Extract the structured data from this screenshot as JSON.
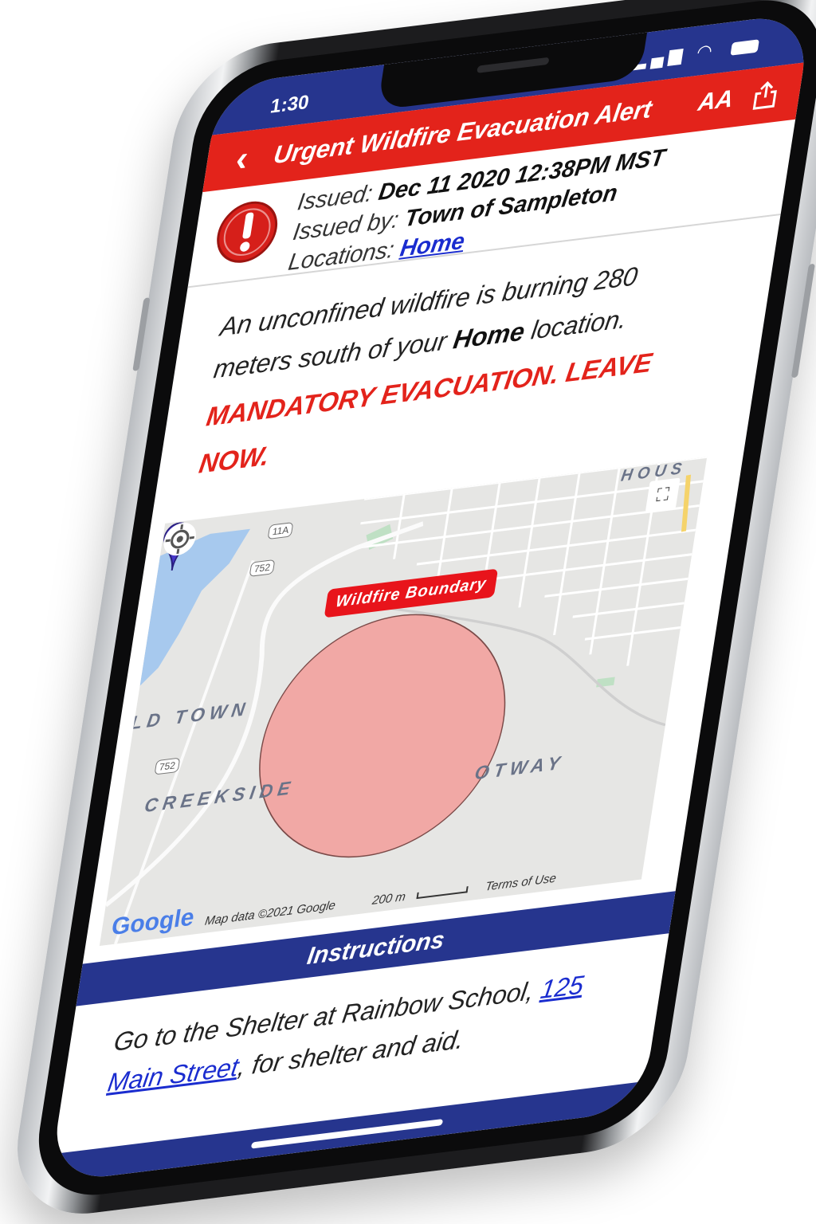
{
  "status_bar": {
    "time": "1:30",
    "signal": "▂▄▆",
    "wifi": "◠"
  },
  "header": {
    "title": "Urgent Wildfire Evacuation Alert",
    "back_label": "‹",
    "text_size_label": "AA"
  },
  "meta": {
    "issued_label": "Issued:",
    "issued_value": "Dec 11 2020 12:38PM MST",
    "issued_by_label": "Issued by:",
    "issued_by_value": "Town of Sampleton",
    "locations_label": "Locations:",
    "locations_value": "Home"
  },
  "message": {
    "part1": "An unconfined wildfire is burning 280 meters south of your ",
    "bold": "Home",
    "part2": " location.",
    "urgent": "MANDATORY EVACUATION. LEAVE NOW."
  },
  "map": {
    "boundary_label": "Wildfire Boundary",
    "labels": {
      "old_town": "LD TOWN",
      "creekside": "CREEKSIDE",
      "otway": "OTWAY",
      "houston": "HOUS"
    },
    "shields": [
      "11A",
      "752",
      "752"
    ],
    "logo": "Google",
    "attribution": "Map data ©2021 Google",
    "scale": "200 m",
    "terms": "Terms of Use",
    "fire_color": "#f1a8a5",
    "pin_color": "#4636c8"
  },
  "instructions": {
    "heading": "Instructions",
    "text1": "Go to the Shelter at Rainbow School, ",
    "link": "125 Main Street",
    "text2": ", for shelter and aid."
  }
}
